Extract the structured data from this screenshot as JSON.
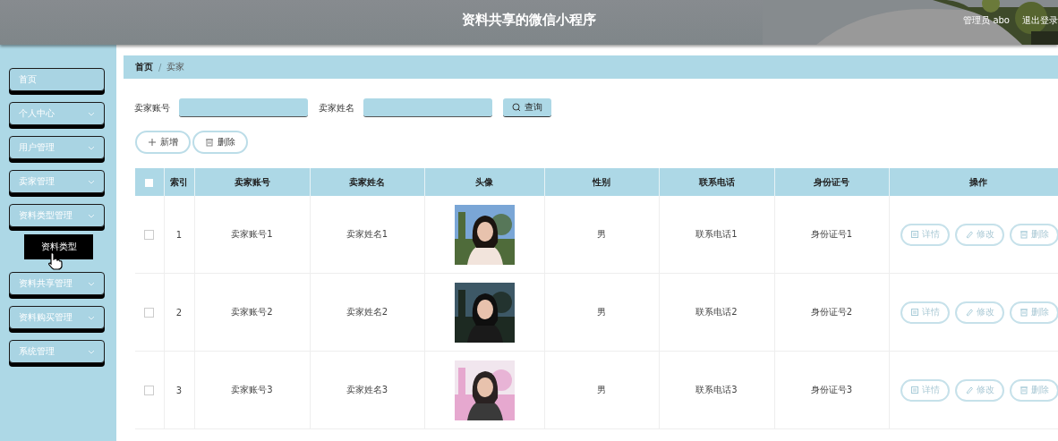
{
  "header": {
    "title": "资料共享的微信小程序",
    "user": "管理员 abo",
    "logout": "退出登录"
  },
  "sidebar": {
    "items": [
      {
        "label": "首页",
        "expandable": false
      },
      {
        "label": "个人中心",
        "expandable": true
      },
      {
        "label": "用户管理",
        "expandable": true
      },
      {
        "label": "卖家管理",
        "expandable": true
      },
      {
        "label": "资料类型管理",
        "expandable": true,
        "children": [
          {
            "label": "资料类型",
            "hovered": true
          }
        ]
      },
      {
        "label": "资料共享管理",
        "expandable": true
      },
      {
        "label": "资料购买管理",
        "expandable": true
      },
      {
        "label": "系统管理",
        "expandable": true
      }
    ]
  },
  "breadcrumb": {
    "items": [
      "首页",
      "卖家"
    ],
    "separator": "/"
  },
  "search": {
    "fields": [
      {
        "label": "卖家账号"
      },
      {
        "label": "卖家姓名"
      }
    ],
    "button": "查询"
  },
  "toolbar": [
    {
      "label": "新增",
      "kind": "add"
    },
    {
      "label": "删除",
      "kind": "delete"
    }
  ],
  "table": {
    "all_selected": false,
    "columns": [
      "索引",
      "卖家账号",
      "卖家姓名",
      "头像",
      "性别",
      "联系电话",
      "身份证号",
      "操作"
    ],
    "rows": [
      {
        "selected": false,
        "index": "1",
        "account": "卖家账号1",
        "name": "卖家姓名1",
        "gender": "男",
        "phone": "联系电话1",
        "id_number": "身份证号1",
        "actions": [
          {
            "label": "详情",
            "kind": "detail"
          },
          {
            "label": "修改",
            "kind": "edit"
          },
          {
            "label": "删除",
            "kind": "delete"
          }
        ]
      },
      {
        "selected": false,
        "index": "2",
        "account": "卖家账号2",
        "name": "卖家姓名2",
        "gender": "男",
        "phone": "联系电话2",
        "id_number": "身份证号2",
        "actions": [
          {
            "label": "详情",
            "kind": "detail"
          },
          {
            "label": "修改",
            "kind": "edit"
          },
          {
            "label": "删除",
            "kind": "delete"
          }
        ]
      },
      {
        "selected": false,
        "index": "3",
        "account": "卖家账号3",
        "name": "卖家姓名3",
        "gender": "男",
        "phone": "联系电话3",
        "id_number": "身份证号3",
        "actions": [
          {
            "label": "详情",
            "kind": "detail"
          },
          {
            "label": "修改",
            "kind": "edit"
          },
          {
            "label": "删除",
            "kind": "delete"
          }
        ]
      }
    ]
  }
}
